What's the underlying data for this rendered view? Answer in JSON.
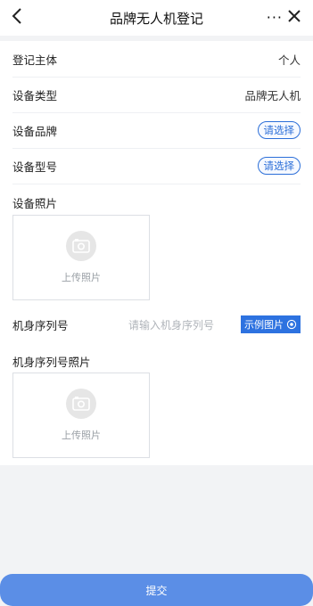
{
  "nav": {
    "title": "品牌无人机登记",
    "more_label": "···"
  },
  "form": {
    "rows": [
      {
        "label": "登记主体",
        "value": "个人"
      },
      {
        "label": "设备类型",
        "value": "品牌无人机"
      },
      {
        "label": "设备品牌",
        "value": "请选择"
      },
      {
        "label": "设备型号",
        "value": "请选择"
      }
    ],
    "device_photo": {
      "label": "设备照片",
      "upload_text": "上传照片"
    },
    "serial": {
      "label": "机身序列号",
      "placeholder": "请输入机身序列号",
      "example_label": "示例图片"
    },
    "serial_photo": {
      "label": "机身序列号照片",
      "upload_text": "上传照片"
    }
  },
  "submit_label": "提交",
  "colors": {
    "accent": "#2d72e0",
    "submit": "#5b8ee6"
  },
  "icons": [
    "back-arrow-icon",
    "close-icon",
    "camera-icon",
    "eye-icon"
  ]
}
